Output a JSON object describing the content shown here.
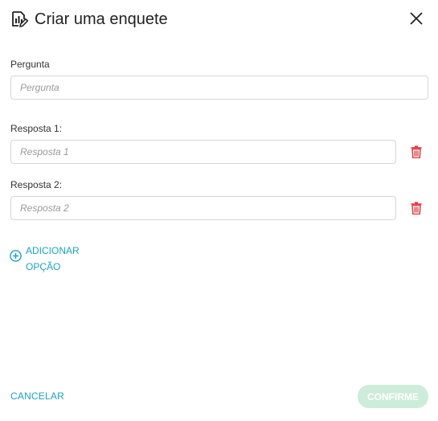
{
  "dialog": {
    "title": "Criar uma enquete",
    "title_icon": "poll-edit-icon",
    "close_icon": "close-icon"
  },
  "question": {
    "label": "Pergunta",
    "placeholder": "Pergunta",
    "value": ""
  },
  "answers": [
    {
      "label": "Resposta 1:",
      "placeholder": "Resposta 1",
      "value": "",
      "delete_icon": "trash-icon"
    },
    {
      "label": "Resposta 2:",
      "placeholder": "Resposta 2",
      "value": "",
      "delete_icon": "trash-icon"
    }
  ],
  "add_option": {
    "label": "ADICIONAR OPÇÃO",
    "icon": "plus-circle-icon"
  },
  "footer": {
    "cancel_label": "CANCELAR",
    "confirm_label": "CONFIRME"
  },
  "colors": {
    "accent": "#1aa1c4",
    "danger": "#e0393e",
    "confirm_disabled_bg": "#cdecd9",
    "input_border": "#d6d6d6"
  }
}
